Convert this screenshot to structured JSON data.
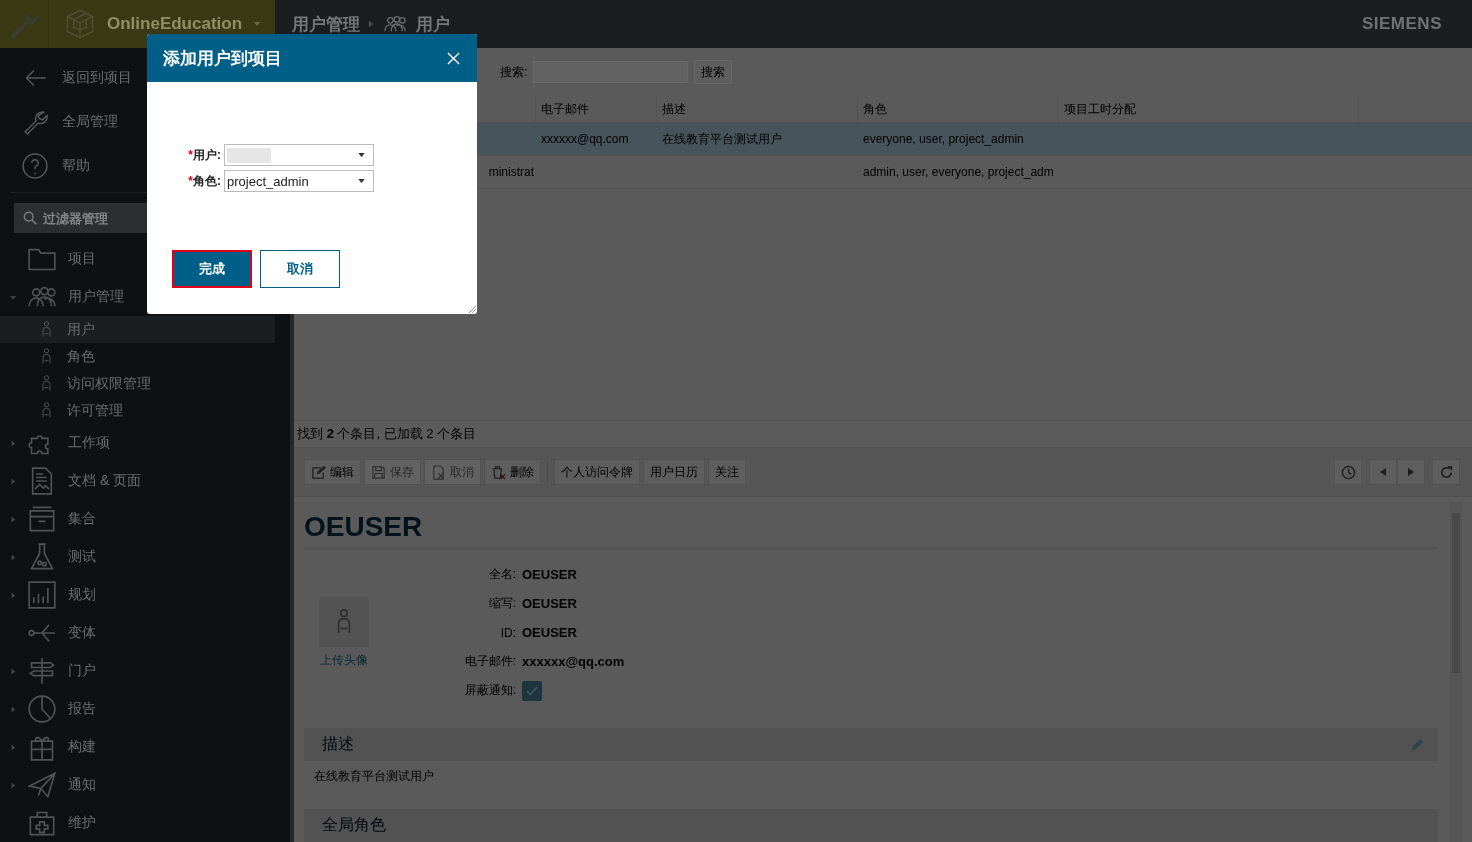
{
  "header": {
    "project": "OnlineEducation",
    "breadcrumb": [
      "用户管理",
      "用户"
    ],
    "brand": "SIEMENS"
  },
  "sidebar": {
    "top_items": [
      {
        "label": "返回到项目"
      },
      {
        "label": "全局管理"
      },
      {
        "label": "帮助"
      }
    ],
    "filter": {
      "placeholder": "过滤器管理"
    },
    "items": [
      {
        "label": "项目",
        "kind": "link"
      },
      {
        "label": "用户管理",
        "kind": "group",
        "expanded": true,
        "children": [
          {
            "label": "用户",
            "selected": true
          },
          {
            "label": "角色",
            "selected": false
          },
          {
            "label": "访问权限管理",
            "selected": false
          },
          {
            "label": "许可管理",
            "selected": false
          }
        ]
      },
      {
        "label": "工作项",
        "kind": "group",
        "expanded": false
      },
      {
        "label": "文档 & 页面",
        "kind": "group",
        "expanded": false
      },
      {
        "label": "集合",
        "kind": "group",
        "expanded": false
      },
      {
        "label": "测试",
        "kind": "group",
        "expanded": false
      },
      {
        "label": "规划",
        "kind": "group",
        "expanded": false
      },
      {
        "label": "变体",
        "kind": "link"
      },
      {
        "label": "门户",
        "kind": "group",
        "expanded": false
      },
      {
        "label": "报告",
        "kind": "group",
        "expanded": false
      },
      {
        "label": "构建",
        "kind": "group",
        "expanded": false
      },
      {
        "label": "通知",
        "kind": "group",
        "expanded": false
      },
      {
        "label": "维护",
        "kind": "link"
      }
    ]
  },
  "list": {
    "search": {
      "label": "搜索:",
      "button": "搜索"
    },
    "columns": {
      "email": "电子邮件",
      "description": "描述",
      "roles": "角色",
      "hours": "项目工时分配"
    },
    "rows": [
      {
        "selected": true,
        "email": "xxxxxx@qq.com",
        "description": "在线教育平台测试用户",
        "roles": "everyone, user, project_admin"
      },
      {
        "selected": false,
        "name_tail": "ministrat",
        "roles": "admin, user, everyone, project_adm"
      }
    ],
    "status": "找到 **2** 个条目, 已加载 2 个条目"
  },
  "toolbar": {
    "buttons": [
      {
        "label": "编辑",
        "kind": "edit",
        "disabled": false
      },
      {
        "label": "保存",
        "kind": "save",
        "disabled": true
      },
      {
        "label": "取消",
        "kind": "cancel",
        "disabled": true
      },
      {
        "label": "删除",
        "kind": "delete",
        "disabled": false
      },
      {
        "label": "个人访问令牌",
        "kind": "text",
        "disabled": false
      },
      {
        "label": "用户日历",
        "kind": "text",
        "disabled": false
      },
      {
        "label": "关注",
        "kind": "text",
        "disabled": false
      }
    ]
  },
  "detail": {
    "title": "OEUSER",
    "avatar_link": "上传头像",
    "fields": [
      {
        "kind": "text",
        "label": "全名:",
        "value": "OEUSER"
      },
      {
        "kind": "text",
        "label": "缩写:",
        "value": "OEUSER"
      },
      {
        "kind": "text",
        "label": "ID:",
        "value": "OEUSER"
      },
      {
        "kind": "text",
        "label": "电子邮件:",
        "value": "xxxxxx@qq.com"
      },
      {
        "kind": "checkbox",
        "label": "屏蔽通知:",
        "checked": true
      }
    ],
    "sections": [
      {
        "title": "描述",
        "editable": true,
        "text": "在线教育平台测试用户"
      },
      {
        "title": "全局角色",
        "editable": false
      }
    ]
  },
  "dialog": {
    "title": "添加用户到项目",
    "fields": [
      {
        "label": "用户:",
        "required_mark": "*",
        "value_redacted": true
      },
      {
        "label": "角色:",
        "required_mark": "*",
        "value": "project_admin"
      }
    ],
    "buttons": [
      {
        "label": "完成",
        "kind": "primary",
        "focused": true
      },
      {
        "label": "取消",
        "kind": "secondary",
        "focused": false
      }
    ]
  }
}
